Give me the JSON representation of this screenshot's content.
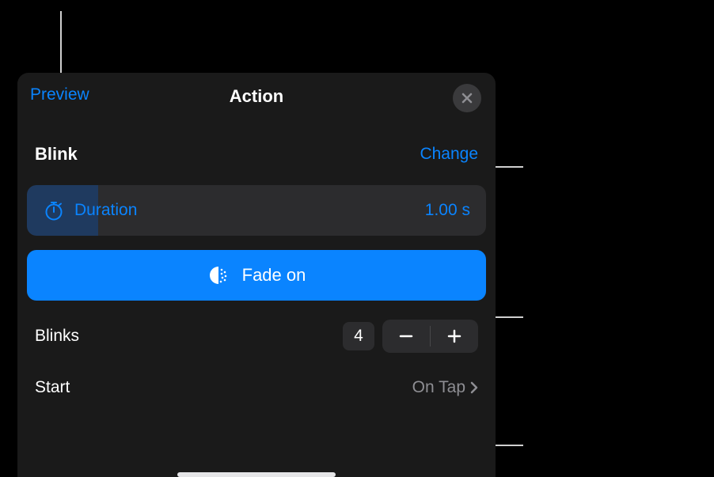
{
  "header": {
    "preview": "Preview",
    "title": "Action"
  },
  "effect": {
    "name": "Blink",
    "change": "Change"
  },
  "duration": {
    "label": "Duration",
    "value": "1.00 s"
  },
  "fade": {
    "label": "Fade on"
  },
  "blinks": {
    "label": "Blinks",
    "value": "4"
  },
  "start": {
    "label": "Start",
    "value": "On Tap"
  },
  "colors": {
    "accent": "#0a84ff",
    "panel": "#1a1a1a",
    "control": "#2c2c2e",
    "secondary": "#8e8e93"
  }
}
